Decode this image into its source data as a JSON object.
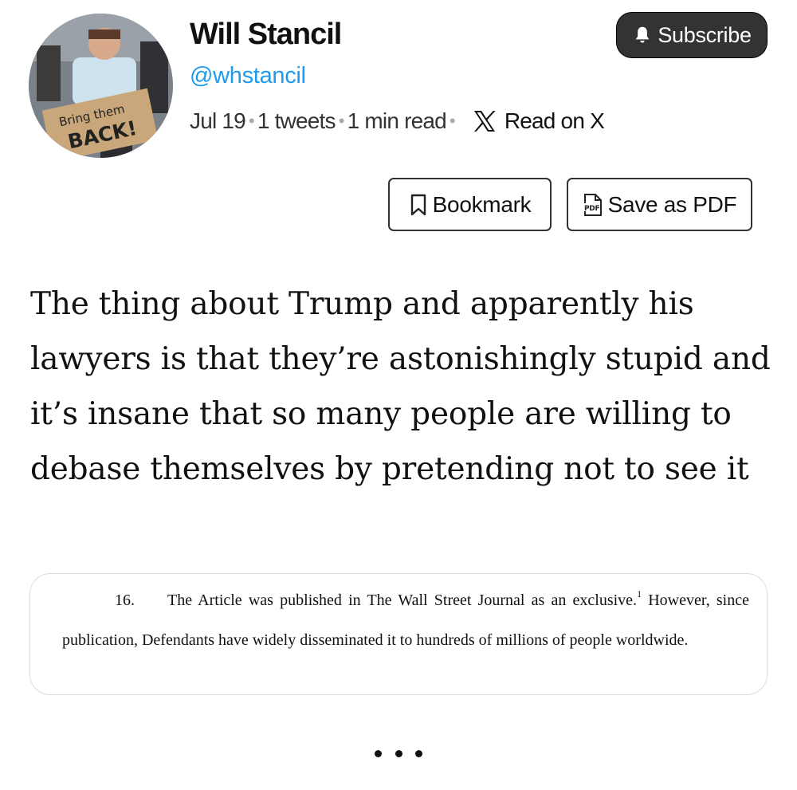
{
  "author": {
    "name": "Will Stancil",
    "handle": "@whstancil",
    "avatar_sign_line1": "Bring them",
    "avatar_sign_line2": "BACK!"
  },
  "meta": {
    "date": "Jul 19",
    "tweets": "1 tweets",
    "read_time": "1 min read",
    "read_on_x": "Read on X"
  },
  "actions": {
    "subscribe_label": "Subscribe",
    "bookmark_label": "Bookmark",
    "save_pdf_label": "Save as PDF",
    "pdf_icon_text": "PDF"
  },
  "tweet": {
    "text": "The thing about Trump and apparently his lawyers is that they’re astonishingly stupid and it’s insane that so many people are willing to debase themselves by pretending not to see it"
  },
  "document_excerpt": {
    "paragraph_number": "16.",
    "text_before_footnote": "The Article was published in The Wall Street Journal as an exclusive.",
    "footnote_marker": "1",
    "text_after_footnote": " However, since publication, Defendants have widely disseminated it to hundreds of millions of people worldwide."
  },
  "icons": {
    "subscribe": "bell-icon",
    "read_on_x": "x-logo-icon",
    "bookmark": "bookmark-icon",
    "save_pdf": "pdf-file-icon",
    "more": "more-dots-icon"
  },
  "colors": {
    "handle": "#1d9bf0",
    "subscribe_bg": "#333333",
    "text": "#111111"
  }
}
